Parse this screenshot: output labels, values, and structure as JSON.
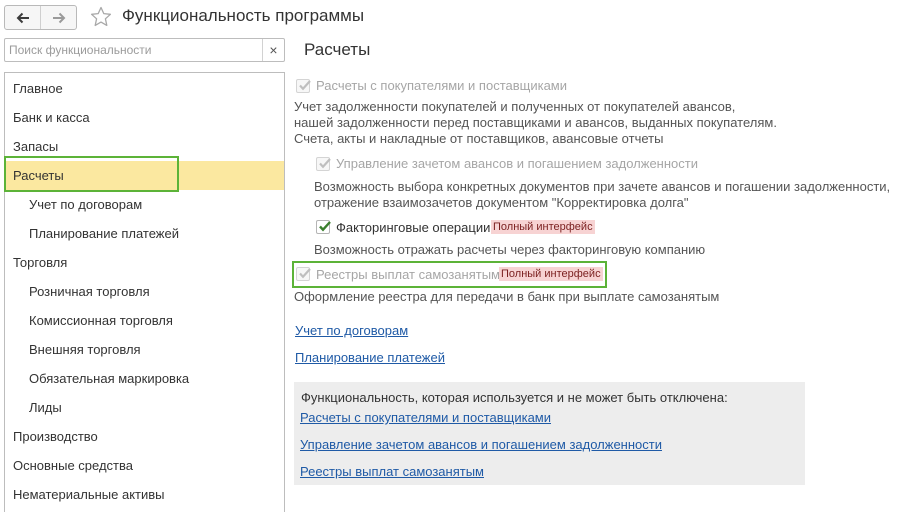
{
  "header": {
    "title": "Функциональность программы",
    "back_icon": "arrow-left-icon",
    "forward_icon": "arrow-right-icon",
    "favorite_icon": "star-icon"
  },
  "search": {
    "placeholder": "Поиск функциональности",
    "value": "",
    "clear_glyph": "×"
  },
  "sidebar": {
    "items": [
      {
        "label": "Главное",
        "level": 0,
        "active": false
      },
      {
        "label": "Банк и касса",
        "level": 0,
        "active": false
      },
      {
        "label": "Запасы",
        "level": 0,
        "active": false
      },
      {
        "label": "Расчеты",
        "level": 0,
        "active": true
      },
      {
        "label": "Учет по договорам",
        "level": 1,
        "active": false
      },
      {
        "label": "Планирование платежей",
        "level": 1,
        "active": false
      },
      {
        "label": "Торговля",
        "level": 0,
        "active": false
      },
      {
        "label": "Розничная торговля",
        "level": 1,
        "active": false
      },
      {
        "label": "Комиссионная торговля",
        "level": 1,
        "active": false
      },
      {
        "label": "Внешняя торговля",
        "level": 1,
        "active": false
      },
      {
        "label": "Обязательная маркировка",
        "level": 1,
        "active": false
      },
      {
        "label": "Лиды",
        "level": 1,
        "active": false
      },
      {
        "label": "Производство",
        "level": 0,
        "active": false
      },
      {
        "label": "Основные средства",
        "level": 0,
        "active": false
      },
      {
        "label": "Нематериальные активы",
        "level": 0,
        "active": false
      }
    ]
  },
  "main": {
    "section_title": "Расчеты",
    "options": [
      {
        "label": "Расчеты с покупателями и поставщиками",
        "checked": true,
        "enabled": false,
        "badge": "",
        "description": [
          "Учет задолженности покупателей и полученных от покупателей авансов,",
          "нашей задолженности перед поставщиками и авансов, выданных покупателям.",
          "Счета, акты и накладные от поставщиков, авансовые отчеты"
        ]
      },
      {
        "label": "Управление зачетом авансов и погашением задолженности",
        "checked": true,
        "enabled": false,
        "badge": "",
        "description": [
          "Возможность выбора конкретных документов при зачете авансов и погашении задолженности,",
          "отражение взаимозачетов документом \"Корректировка долга\""
        ]
      },
      {
        "label": "Факторинговые операции",
        "checked": true,
        "enabled": true,
        "badge": "Полный интерфейс",
        "description": [
          "Возможность отражать расчеты через факторинговую компанию"
        ]
      },
      {
        "label": "Реестры выплат самозанятым",
        "checked": true,
        "enabled": false,
        "badge": "Полный интерфейс",
        "description": [
          "Оформление реестра для передачи в банк при выплате самозанятым"
        ]
      }
    ],
    "links": [
      "Учет по договорам",
      "Планирование платежей"
    ],
    "always_on": {
      "note": "Функциональность, которая используется и не может быть отключена:",
      "links": [
        "Расчеты с покупателями и поставщиками",
        "Управление зачетом авансов и погашением задолженности",
        "Реестры выплат самозанятым"
      ]
    }
  },
  "colors": {
    "accent_highlight": "#5cb338",
    "active_row": "#fbe8a0",
    "badge_bg": "#f7d3d3",
    "link": "#1f5aa6",
    "check_enabled": "#3a7f2d",
    "check_disabled": "#bfbfbf"
  }
}
